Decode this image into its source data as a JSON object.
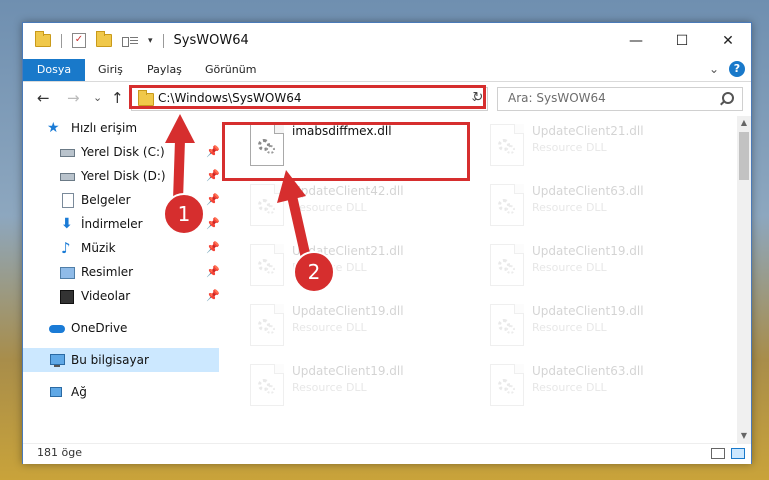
{
  "window": {
    "title": "SysWOW64"
  },
  "quick_access_toolbar": {
    "dropdown": "▾"
  },
  "window_buttons": {
    "minimize": "—",
    "maximize": "☐",
    "close": "✕"
  },
  "ribbon": {
    "tabs": [
      "Dosya",
      "Giriş",
      "Paylaş",
      "Görünüm"
    ],
    "expand_glyph": "⌄",
    "help": "?"
  },
  "navigation": {
    "back": "←",
    "forward": "→",
    "recent": "⌄",
    "up": "↑"
  },
  "address": {
    "path": "C:\\Windows\\SysWOW64",
    "dropdown": "⌄",
    "refresh": "↻"
  },
  "search": {
    "placeholder": "Ara: SysWOW64"
  },
  "sidebar": {
    "items": [
      {
        "label": "Hızlı erişim",
        "icon": "star-icon"
      },
      {
        "label": "Yerel Disk (C:)",
        "icon": "drive-icon",
        "pinned": true
      },
      {
        "label": "Yerel Disk (D:)",
        "icon": "drive-icon",
        "pinned": true
      },
      {
        "label": "Belgeler",
        "icon": "document-icon",
        "pinned": true
      },
      {
        "label": "İndirmeler",
        "icon": "download-icon",
        "pinned": true
      },
      {
        "label": "Müzik",
        "icon": "music-icon",
        "pinned": true
      },
      {
        "label": "Resimler",
        "icon": "pictures-icon",
        "pinned": true
      },
      {
        "label": "Videolar",
        "icon": "videos-icon",
        "pinned": true
      },
      {
        "label": "OneDrive",
        "icon": "cloud-icon"
      },
      {
        "label": "Bu bilgisayar",
        "icon": "computer-icon",
        "selected": true
      },
      {
        "label": "Ağ",
        "icon": "network-icon"
      }
    ],
    "pin_glyph": "📌",
    "star_glyph": "★",
    "download_glyph": "⬇",
    "music_glyph": "♪"
  },
  "files": [
    {
      "name": "imabsdiffmex.dll",
      "type": "",
      "highlight": true
    },
    {
      "name": "UpdateClient21.dll",
      "type": "Resource DLL"
    },
    {
      "name": "UpdateClient42.dll",
      "type": "Resource DLL"
    },
    {
      "name": "UpdateClient63.dll",
      "type": "Resource DLL"
    },
    {
      "name": "UpdateClient21.dll",
      "type": "Resource DLL"
    },
    {
      "name": "UpdateClient19.dll",
      "type": "Resource DLL"
    },
    {
      "name": "UpdateClient19.dll",
      "type": "Resource DLL"
    },
    {
      "name": "UpdateClient19.dll",
      "type": "Resource DLL"
    },
    {
      "name": "UpdateClient19.dll",
      "type": "Resource DLL"
    },
    {
      "name": "UpdateClient63.dll",
      "type": "Resource DLL"
    }
  ],
  "status": {
    "item_count": "181 öge"
  },
  "scrollbar": {
    "up": "▲",
    "down": "▼"
  },
  "annotations": {
    "step1": "1",
    "step2": "2",
    "color": "#d62e2e"
  }
}
